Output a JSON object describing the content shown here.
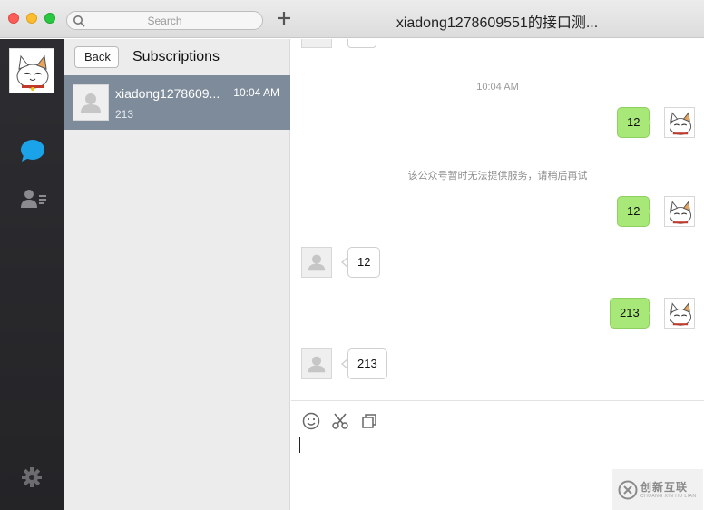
{
  "window": {
    "title": "xiadong1278609551的接口测..."
  },
  "search": {
    "placeholder": "Search"
  },
  "sidebar": {
    "icons": [
      "cat-avatar",
      "chat-bubble-icon",
      "contacts-icon",
      "settings-gear-icon"
    ],
    "active_color": "#1aa3e8"
  },
  "middle": {
    "back_label": "Back",
    "title": "Subscriptions",
    "conversations": [
      {
        "name": "xiadong1278609...",
        "time": "10:04 AM",
        "preview": "213"
      }
    ]
  },
  "chat": {
    "timestamp": "10:04 AM",
    "system_notice": "该公众号暂时无法提供服务，请稍后再试",
    "messages": [
      {
        "direction": "out",
        "text": "12"
      },
      {
        "direction": "out",
        "text": "12"
      },
      {
        "direction": "in",
        "text": "12"
      },
      {
        "direction": "out",
        "text": "213"
      },
      {
        "direction": "in",
        "text": "213"
      }
    ],
    "outgoing_color": "#a7e878"
  },
  "composer": {
    "tools": [
      "emoji-icon",
      "scissors-icon",
      "copy-icon"
    ]
  },
  "watermark": {
    "text": "创新互联",
    "sub": "CHUANG XIN HU LIAN"
  }
}
